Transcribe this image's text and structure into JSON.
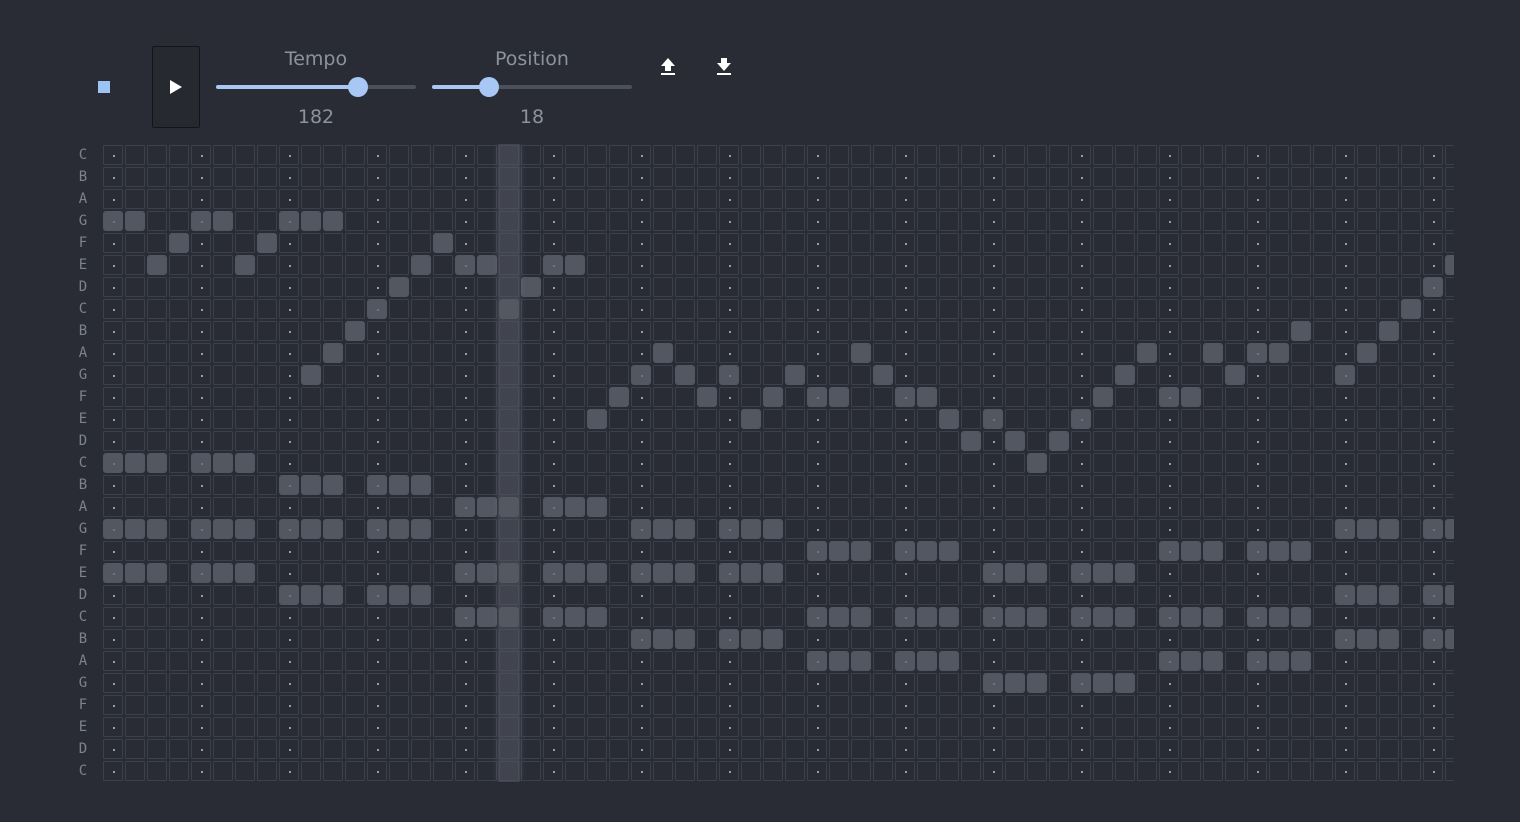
{
  "transport": {
    "stop_icon": "stop-icon",
    "play_icon": "play-icon",
    "upload_icon": "upload-icon",
    "download_icon": "download-icon"
  },
  "tempo": {
    "label": "Tempo",
    "value": "182",
    "min": 40,
    "max": 240,
    "current": 182
  },
  "position": {
    "label": "Position",
    "value": "18",
    "min": 0,
    "max": 63,
    "current": 18
  },
  "colors": {
    "accent": "#a8c7f4",
    "background": "#292c35",
    "note_on": "#535761",
    "grid_line": "#3c404a"
  },
  "grid": {
    "note_labels": [
      "C",
      "B",
      "A",
      "G",
      "F",
      "E",
      "D",
      "C",
      "B",
      "A",
      "G",
      "F",
      "E",
      "D",
      "C",
      "B",
      "A",
      "G",
      "F",
      "E",
      "D",
      "C",
      "B",
      "A",
      "G",
      "F",
      "E",
      "D",
      "C"
    ],
    "columns": 62,
    "beat_every": 4,
    "playhead_step": 18,
    "active_steps": [
      [],
      [],
      [],
      [
        0,
        1,
        4,
        5,
        8,
        9,
        10
      ],
      [
        3,
        7,
        15
      ],
      [
        2,
        6,
        14,
        16,
        17,
        20,
        21,
        61
      ],
      [
        13,
        19,
        60
      ],
      [
        12,
        18,
        59
      ],
      [
        11,
        54,
        58
      ],
      [
        10,
        25,
        34,
        47,
        50,
        52,
        53,
        57
      ],
      [
        9,
        24,
        26,
        28,
        31,
        35,
        46,
        51,
        56
      ],
      [
        23,
        27,
        30,
        32,
        33,
        36,
        37,
        45,
        48,
        49
      ],
      [
        22,
        29,
        38,
        40,
        44
      ],
      [
        39,
        41,
        43
      ],
      [
        0,
        1,
        2,
        4,
        5,
        6,
        42
      ],
      [
        8,
        9,
        10,
        12,
        13,
        14
      ],
      [
        16,
        17,
        18,
        20,
        21,
        22
      ],
      [
        0,
        1,
        2,
        4,
        5,
        6,
        8,
        9,
        10,
        12,
        13,
        14,
        24,
        25,
        26,
        28,
        29,
        30,
        56,
        57,
        58,
        60,
        61
      ],
      [
        32,
        33,
        34,
        36,
        37,
        38,
        48,
        49,
        50,
        52,
        53,
        54
      ],
      [
        0,
        1,
        2,
        4,
        5,
        6,
        16,
        17,
        18,
        20,
        21,
        22,
        24,
        25,
        26,
        28,
        29,
        30,
        40,
        41,
        42,
        44,
        45,
        46
      ],
      [
        8,
        9,
        10,
        12,
        13,
        14,
        56,
        57,
        58,
        60,
        61
      ],
      [
        16,
        17,
        18,
        20,
        21,
        22,
        32,
        33,
        34,
        36,
        37,
        38,
        40,
        41,
        42,
        44,
        45,
        46,
        48,
        49,
        50,
        52,
        53,
        54
      ],
      [
        24,
        25,
        26,
        28,
        29,
        30,
        56,
        57,
        58,
        60,
        61
      ],
      [
        32,
        33,
        34,
        36,
        37,
        38,
        48,
        49,
        50,
        52,
        53,
        54
      ],
      [
        40,
        41,
        42,
        44,
        45,
        46
      ],
      [],
      [],
      [],
      []
    ]
  }
}
